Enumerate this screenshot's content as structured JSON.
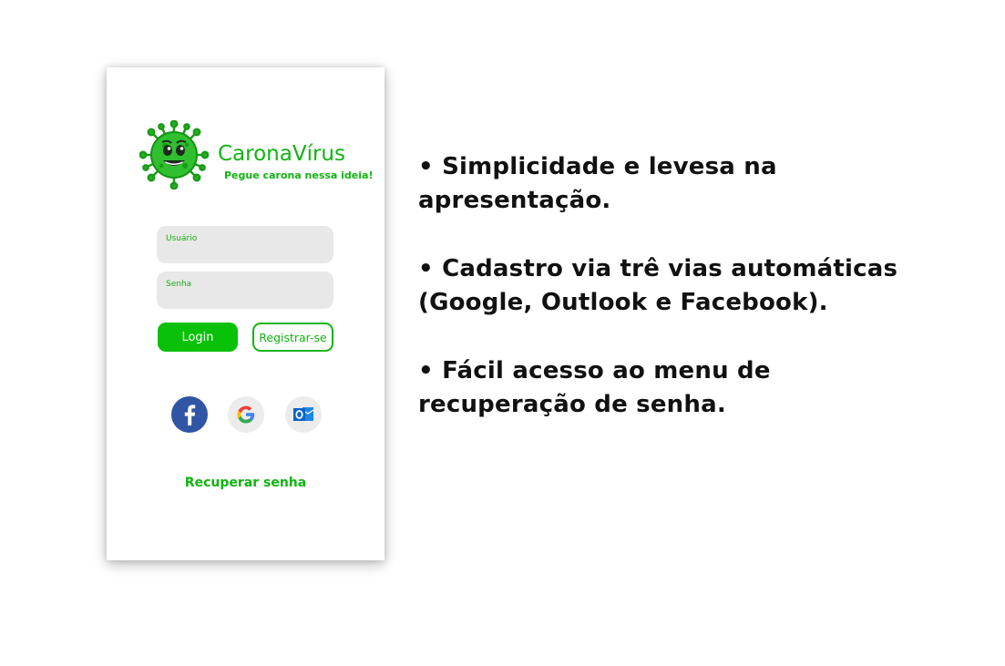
{
  "app": {
    "title": "CaronaVírus",
    "tagline": "Pegue carona nessa ideia!"
  },
  "form": {
    "username_label": "Usuário",
    "username_value": "",
    "password_label": "Senha",
    "password_value": "",
    "login_button": "Login",
    "register_button": "Registrar-se"
  },
  "social": [
    {
      "name": "Facebook",
      "icon": "facebook-icon"
    },
    {
      "name": "Google",
      "icon": "google-icon"
    },
    {
      "name": "Outlook",
      "icon": "outlook-icon"
    }
  ],
  "recover_link": "Recuperar senha",
  "features": [
    {
      "line1": "• Simplicidade e levesa na",
      "line2": "apresentação."
    },
    {
      "line1": "• Cadastro via trê vias automáticas",
      "line2": "(Google, Outlook e Facebook)."
    },
    {
      "line1": "• Fácil acesso ao menu de",
      "line2": "recuperação de senha."
    }
  ],
  "colors": {
    "brand_green": "#12b312",
    "login_green": "#08c108",
    "field_gray": "#e8e8e8",
    "facebook_blue": "#2f55a4",
    "outlook_blue": "#0a64c8"
  }
}
